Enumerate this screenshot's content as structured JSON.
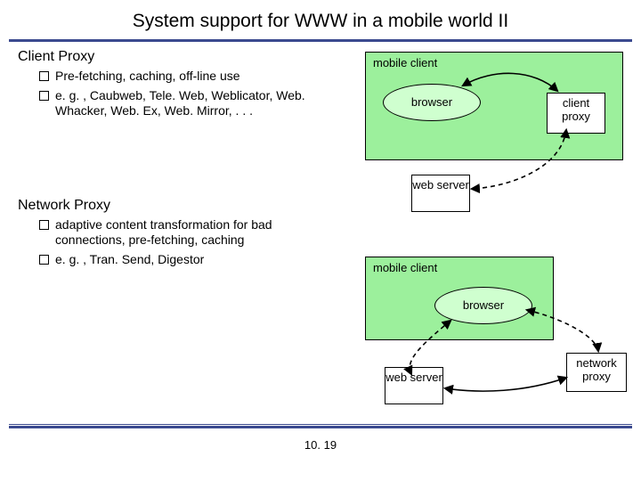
{
  "title": "System support for WWW in a mobile world II",
  "page_number": "10. 19",
  "sections": {
    "client_proxy": {
      "heading": "Client Proxy",
      "items": [
        "Pre-fetching, caching, off-line use",
        "e. g. , Caubweb, Tele. Web, Weblicator, Web. Whacker, Web. Ex, Web. Mirror, . . ."
      ]
    },
    "network_proxy": {
      "heading": "Network Proxy",
      "items": [
        "adaptive content transformation for bad connections, pre-fetching, caching",
        "e. g. , Tran. Send, Digestor"
      ]
    }
  },
  "diagram": {
    "mobile_client": "mobile client",
    "browser": "browser",
    "client_proxy": "client proxy",
    "web_server": "web server",
    "network_proxy": "network proxy"
  }
}
